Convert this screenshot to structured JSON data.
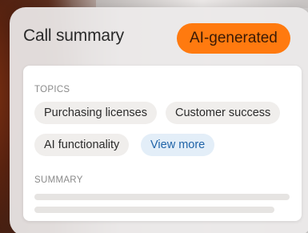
{
  "card": {
    "title": "Call summary",
    "badge": "AI-generated"
  },
  "topics": {
    "label": "TOPICS",
    "items": [
      "Purchasing licenses",
      "Customer success",
      "AI functionality"
    ],
    "view_more": "View more"
  },
  "summary": {
    "label": "SUMMARY"
  },
  "colors": {
    "badge": "#ff7a0f",
    "view_more_text": "#1f63a8",
    "view_more_bg": "#e3eef8"
  }
}
